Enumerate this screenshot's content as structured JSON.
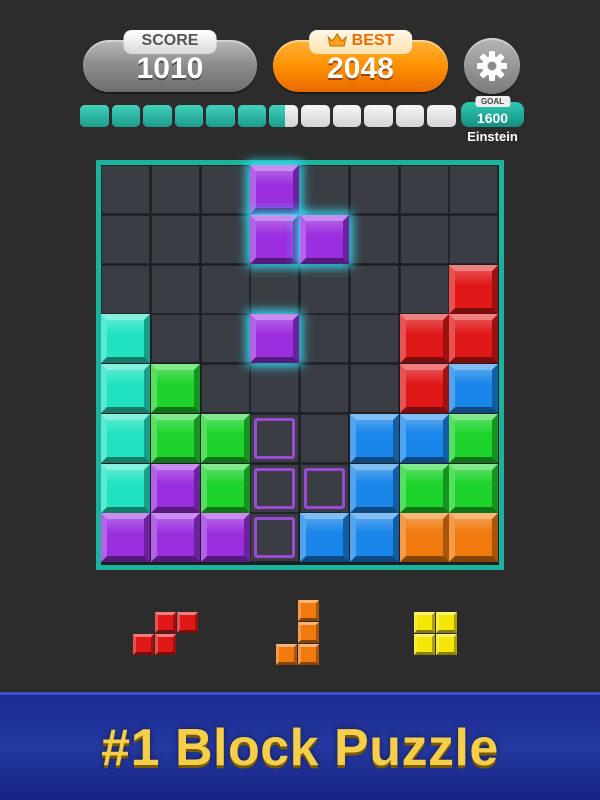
{
  "header": {
    "score_label": "SCORE",
    "score_value": "1010",
    "best_label": "BEST",
    "best_value": "2048",
    "settings_icon": "gear-icon",
    "crown_icon": "crown-icon"
  },
  "progress": {
    "segments_total": 12,
    "filled": 6.55,
    "goal_label": "GOAL",
    "goal_value": "1600",
    "rank": "Einstein"
  },
  "colors": {
    "purple": "#9b2fe0",
    "cyan": "#22e3c1",
    "green": "#1ed42c",
    "red": "#e01818",
    "blue": "#1a86ea",
    "orange": "#f07a0e",
    "yellow": "#f4e606",
    "board_border": "#1bb39d",
    "banner_text": "#f6cf4a"
  },
  "board": {
    "rows": 8,
    "cols": 8,
    "cells": [
      [
        null,
        null,
        null,
        "P*",
        null,
        null,
        null,
        null
      ],
      [
        null,
        null,
        null,
        "P*",
        "P*",
        null,
        null,
        null
      ],
      [
        null,
        null,
        null,
        null,
        null,
        null,
        null,
        "R"
      ],
      [
        "C",
        null,
        null,
        "P*",
        null,
        null,
        "R",
        "R"
      ],
      [
        "C",
        "G",
        null,
        null,
        null,
        null,
        "R",
        "B"
      ],
      [
        "C",
        "G",
        "G",
        "o",
        null,
        "B",
        "B",
        "G"
      ],
      [
        "C",
        "P",
        "G",
        "o",
        "o",
        "B",
        "G",
        "G"
      ],
      [
        "P",
        "P",
        "P",
        "o",
        "B",
        "B",
        "O",
        "O"
      ]
    ]
  },
  "tray": [
    {
      "color": "red",
      "cells": [
        [
          0,
          1
        ],
        [
          0,
          2
        ],
        [
          1,
          0
        ],
        [
          1,
          1
        ]
      ]
    },
    {
      "color": "orange",
      "cells": [
        [
          0,
          1
        ],
        [
          1,
          1
        ],
        [
          2,
          0
        ],
        [
          2,
          1
        ]
      ]
    },
    {
      "color": "yellow",
      "cells": [
        [
          0,
          0
        ],
        [
          0,
          1
        ],
        [
          1,
          0
        ],
        [
          1,
          1
        ]
      ]
    }
  ],
  "banner": {
    "text": "#1 Block Puzzle"
  }
}
